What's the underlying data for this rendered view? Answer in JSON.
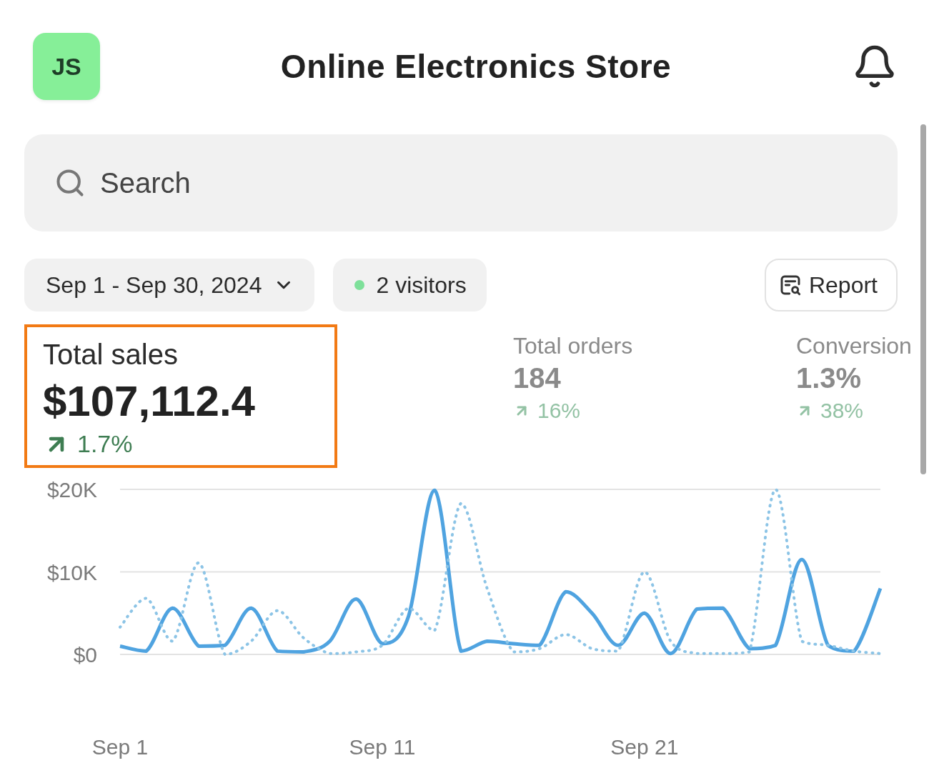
{
  "header": {
    "avatar": "JS",
    "title": "Online Electronics Store"
  },
  "search": {
    "placeholder": "Search"
  },
  "filters": {
    "date_range": "Sep 1 - Sep 30, 2024",
    "visitors": {
      "label": "2 visitors",
      "color": "#7ee09a"
    },
    "report_button": "Report"
  },
  "metrics": [
    {
      "label": "Total sales",
      "value": "$107,112.4",
      "change": "1.7%",
      "selected": true
    },
    {
      "label": "Total orders",
      "value": "184",
      "change": "16%",
      "selected": false
    },
    {
      "label": "Conversion",
      "value": "1.3%",
      "change": "38%",
      "selected": false
    }
  ],
  "chart": {
    "chart_data": {
      "type": "line",
      "categories": [
        "Sep 1",
        null,
        null,
        null,
        null,
        null,
        null,
        null,
        null,
        null,
        "Sep 11",
        null,
        null,
        null,
        null,
        null,
        null,
        null,
        null,
        null,
        "Sep 21",
        null,
        null,
        null,
        null,
        null,
        null,
        null,
        null,
        null
      ],
      "ylim": [
        0,
        20000
      ],
      "yticks": [
        {
          "value": 0,
          "label": "$0"
        },
        {
          "value": 10000,
          "label": "$10K"
        },
        {
          "value": 20000,
          "label": "$20K"
        }
      ],
      "series": [
        {
          "color": "#4fa3e0",
          "line_style": "solid",
          "values": [
            1000,
            400,
            5600,
            1000,
            1100,
            5600,
            400,
            300,
            1600,
            6700,
            1300,
            4600,
            19900,
            400,
            1600,
            1300,
            1100,
            7600,
            5000,
            1100,
            5000,
            100,
            5500,
            5600,
            700,
            1100,
            11500,
            1100,
            400,
            8000
          ]
        },
        {
          "color": "#8cc4e6",
          "line_style": "dotted",
          "values": [
            3300,
            6800,
            1600,
            11100,
            0,
            1600,
            5300,
            2000,
            100,
            300,
            1100,
            5600,
            2900,
            18300,
            8000,
            300,
            700,
            2400,
            700,
            400,
            10000,
            1600,
            100,
            100,
            300,
            20000,
            1600,
            1100,
            400,
            100
          ]
        }
      ]
    }
  }
}
